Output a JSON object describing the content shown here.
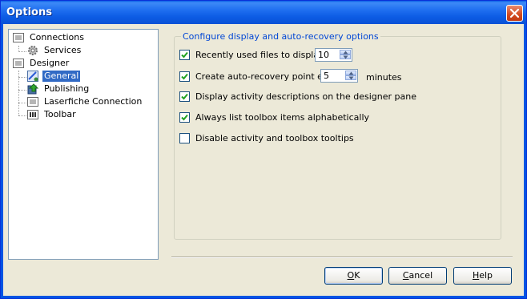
{
  "window": {
    "title": "Options"
  },
  "tree": {
    "connections": "Connections",
    "services": "Services",
    "designer": "Designer",
    "general": "General",
    "publishing": "Publishing",
    "laserfiche": "Laserfiche Connection",
    "toolbar": "Toolbar"
  },
  "group": {
    "legend": "Configure display and auto-recovery options"
  },
  "options": {
    "recent_files_label": "Recently used files to display:",
    "recent_files_value": "10",
    "auto_recovery_label": "Create auto-recovery point every",
    "auto_recovery_value": "5",
    "auto_recovery_unit": "minutes",
    "activity_desc_label": "Display activity descriptions on the designer pane",
    "toolbox_alpha_label": "Always list toolbox items alphabetically",
    "disable_tooltips_label": "Disable activity and toolbox tooltips"
  },
  "buttons": {
    "ok_prefix": "O",
    "ok_rest": "K",
    "cancel_prefix": "C",
    "cancel_rest": "ancel",
    "help_prefix": "H",
    "help_rest": "elp"
  }
}
